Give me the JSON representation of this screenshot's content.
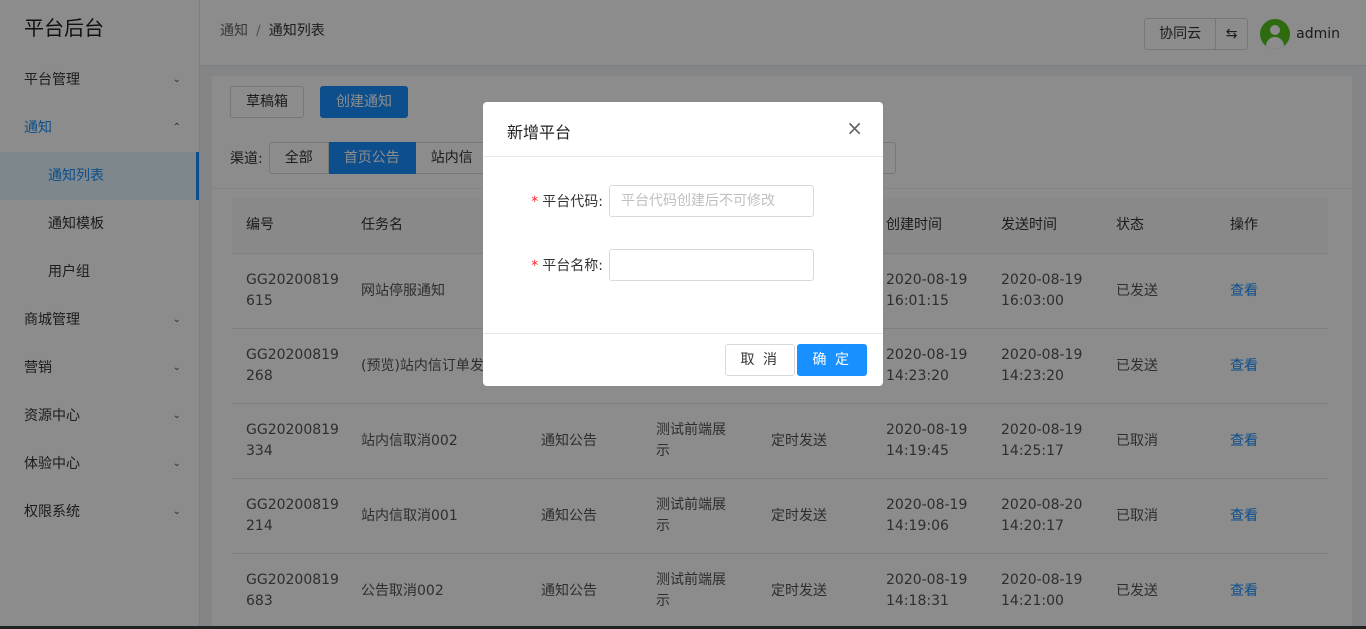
{
  "sidebar": {
    "brand": "平台后台",
    "menu": [
      {
        "label": "平台管理"
      },
      {
        "label": "通知"
      },
      {
        "label": "商城管理"
      },
      {
        "label": "营销"
      },
      {
        "label": "资源中心"
      },
      {
        "label": "体验中心"
      },
      {
        "label": "权限系统"
      }
    ],
    "sub_items": [
      {
        "label": "通知列表"
      },
      {
        "label": "通知模板"
      },
      {
        "label": "用户组"
      }
    ]
  },
  "header": {
    "breadcrumb": [
      "通知",
      "通知列表"
    ],
    "breadcrumb_sep": "/",
    "cloud_button": "协同云",
    "swap_icon": "⇆",
    "user": "admin"
  },
  "toolbar": {
    "drafts": "草稿箱",
    "create": "创建通知"
  },
  "channel": {
    "label": "渠道:",
    "options": [
      "全部",
      "首页公告",
      "站内信"
    ]
  },
  "table": {
    "headers": [
      "编号",
      "任务名",
      "",
      "",
      "",
      "创建时间",
      "发送时间",
      "状态",
      "操作"
    ],
    "rows": [
      [
        "GG20200819\n615",
        "网站停服通知",
        "",
        "",
        "",
        "2020-08-19\n16:01:15",
        "2020-08-19\n16:03:00",
        "已发送",
        "查看"
      ],
      [
        "GG20200819\n268",
        "(预览)站内信订单发",
        "",
        "",
        "",
        "2020-08-19\n14:23:20",
        "2020-08-19\n14:23:20",
        "已发送",
        "查看"
      ],
      [
        "GG20200819\n334",
        "站内信取消002",
        "通知公告",
        "测试前端展\n示",
        "定时发送",
        "2020-08-19\n14:19:45",
        "2020-08-19\n14:25:17",
        "已取消",
        "查看"
      ],
      [
        "GG20200819\n214",
        "站内信取消001",
        "通知公告",
        "测试前端展\n示",
        "定时发送",
        "2020-08-19\n14:19:06",
        "2020-08-20\n14:20:17",
        "已取消",
        "查看"
      ],
      [
        "GG20200819\n683",
        "公告取消002",
        "通知公告",
        "测试前端展\n示",
        "定时发送",
        "2020-08-19\n14:18:31",
        "2020-08-19\n14:21:00",
        "已发送",
        "查看"
      ]
    ]
  },
  "modal": {
    "title": "新增平台",
    "close_icon": "×",
    "fields": [
      {
        "label": "平台代码:",
        "placeholder": "平台代码创建后不可修改",
        "value": ""
      },
      {
        "label": "平台名称:",
        "placeholder": "",
        "value": ""
      }
    ],
    "required_mark": "*",
    "cancel": "取 消",
    "ok": "确 定"
  }
}
